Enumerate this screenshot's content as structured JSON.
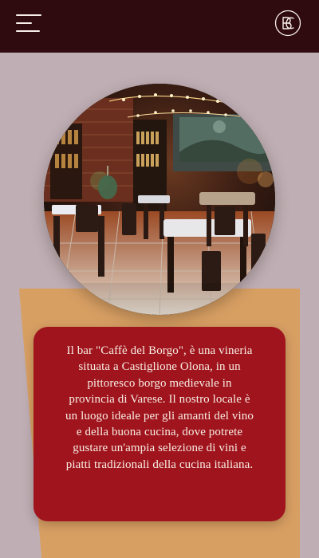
{
  "header": {
    "menu_icon": "hamburger-menu-icon",
    "logo_icon": "caffe-del-borgo-monogram-logo",
    "colors": {
      "background": "#2f0b0f",
      "foreground": "#f6efe9"
    }
  },
  "main": {
    "hero_image": "restaurant-interior-photo",
    "description": "Il bar \"Caffè del Borgo\", è una vineria situata a Castiglione Olona, in un pittoresco borgo medievale in provincia di Varese. Il nostro locale è un luogo ideale per gli amanti del vino e della buona cucina, dove potrete gustare un'ampia selezione di vini e piatti tradizionali della cucina italiana.",
    "colors": {
      "page_background": "#bfaeb3",
      "accent_band": "#d89f63",
      "card_background": "#a0141e",
      "card_text": "#f7eee2"
    }
  }
}
